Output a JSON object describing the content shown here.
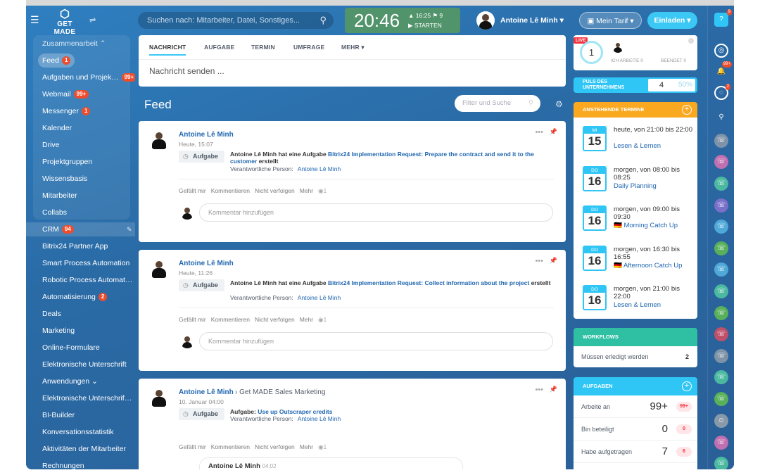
{
  "header": {
    "logo_text": "GET MADE",
    "search_placeholder": "Suchen nach: Mitarbeiter, Datei, Sonstiges...",
    "clock_time": "20:46",
    "clock_meta": "▲ 16:25  ⚑ 9",
    "clock_start": "▶ STARTEN",
    "user_name": "Antoine Lê Minh",
    "tarif_label": "Mein Tarif",
    "invite_label": "Einladen"
  },
  "sidebar": {
    "group_label": "Zusammenarbeit ⌃",
    "items": [
      {
        "label": "Feed",
        "count": "1"
      },
      {
        "label": "Aufgaben und Projek…",
        "count": "99+"
      },
      {
        "label": "Webmail",
        "count": "99+"
      },
      {
        "label": "Messenger",
        "count": "1"
      },
      {
        "label": "Kalender",
        "count": ""
      },
      {
        "label": "Drive",
        "count": ""
      },
      {
        "label": "Projektgruppen",
        "count": ""
      },
      {
        "label": "Wissensbasis",
        "count": ""
      },
      {
        "label": "Mitarbeiter",
        "count": ""
      },
      {
        "label": "Collabs",
        "count": ""
      }
    ],
    "items2": [
      {
        "label": "CRM",
        "count": "94"
      },
      {
        "label": "Bitrix24 Partner App",
        "count": ""
      },
      {
        "label": "Smart Process Automation",
        "count": ""
      },
      {
        "label": "Robotic Process Automat…",
        "count": ""
      },
      {
        "label": "Automatisierung",
        "count": "2"
      },
      {
        "label": "Deals",
        "count": ""
      },
      {
        "label": "Marketing",
        "count": ""
      },
      {
        "label": "Online-Formulare",
        "count": ""
      },
      {
        "label": "Elektronische Unterschrift",
        "count": ""
      },
      {
        "label": "Anwendungen ⌄",
        "count": ""
      },
      {
        "label": "Elektronische Unterschrif…",
        "count": ""
      },
      {
        "label": "BI-Builder",
        "count": ""
      },
      {
        "label": "Konversationsstatistik",
        "count": ""
      },
      {
        "label": "Aktivitäten der Mitarbeiter",
        "count": ""
      },
      {
        "label": "Rechnungen",
        "count": ""
      }
    ]
  },
  "composer": {
    "tabs": [
      "NACHRICHT",
      "AUFGABE",
      "TERMIN",
      "UMFRAGE",
      "MEHR ▾"
    ],
    "placeholder": "Nachricht senden ..."
  },
  "feed": {
    "title": "Feed",
    "filter_placeholder": "Filter und Suche",
    "posts": [
      {
        "author": "Antoine Lê Minh",
        "crumb": "",
        "date": "Heute, 15:07",
        "type": "Aufgabe",
        "text_prefix": "Antoine Lê Minh hat eine Aufgabe ",
        "link": "Bitrix24 Implementation Request: Prepare the contract and send it to the customer",
        "text_suffix": " erstellt",
        "resp_label": "Verantwortliche Person:",
        "resp_name": "Antoine Lê Minh",
        "actions": [
          "Gefällt mir",
          "Kommentieren",
          "Nicht verfolgen",
          "Mehr",
          "◉1"
        ],
        "comment_placeholder": "Kommentar hinzufügen"
      },
      {
        "author": "Antoine Lê Minh",
        "crumb": "",
        "date": "Heute, 11:26",
        "type": "Aufgabe",
        "text_prefix": "Antoine Lê Minh hat eine Aufgabe ",
        "link": "Bitrix24 Implementation Request: Collect information about the project",
        "text_suffix": " erstellt",
        "resp_label": "Verantwortliche Person:",
        "resp_name": "Antoine Lê Minh",
        "actions": [
          "Gefällt mir",
          "Kommentieren",
          "Nicht verfolgen",
          "Mehr",
          "◉1"
        ],
        "comment_placeholder": "Kommentar hinzufügen"
      },
      {
        "author": "Antoine Lê Minh",
        "crumb": "›  Get MADE Sales Marketing",
        "date": "10. Januar 04:00",
        "type": "Aufgabe",
        "text_prefix": "Aufgabe: ",
        "link": "Use up Outscraper credits",
        "text_suffix": "",
        "resp_label": "Verantwortliche Person:",
        "resp_name": "Antoine Lê Minh",
        "actions": [
          "Gefällt mir",
          "Kommentieren",
          "Nicht verfolgen",
          "Mehr",
          "◉1"
        ],
        "comment_author": "Antoine Lê Minh",
        "comment_time": "04:02"
      }
    ]
  },
  "right": {
    "live_tag": "LIVE",
    "live_count": "1",
    "ich_arbeite": "ICH ARBEITE 0",
    "beendet": "BEENDET 0",
    "puls_label": "PULS DES UNTERNEHMENS",
    "puls_value": "4",
    "puls_percent": "50%",
    "termine_title": "ANSTEHENDE TERMINE",
    "events": [
      {
        "dow": "MI",
        "day": "15",
        "when": "heute, von 21:00 bis 22:00",
        "what": "Lesen & Lernen"
      },
      {
        "dow": "DO",
        "day": "16",
        "when": "morgen, von 08:00 bis 08:25",
        "what": "Daily Planning"
      },
      {
        "dow": "DO",
        "day": "16",
        "when": "morgen, von 09:00 bis 09:30",
        "what": "🇩🇪 Morning Catch Up"
      },
      {
        "dow": "DO",
        "day": "16",
        "when": "morgen, von 16:30 bis 16:55",
        "what": "🇩🇪 Afternoon Catch Up"
      },
      {
        "dow": "DO",
        "day": "16",
        "when": "morgen, von 21:00 bis 22:00",
        "what": "Lesen & Lernen"
      }
    ],
    "workflows_title": "WORKFLOWS",
    "workflows_label": "Müssen erledigt werden",
    "workflows_count": "2",
    "aufgaben_title": "AUFGABEN",
    "aufgaben_rows": [
      {
        "label": "Arbeite an",
        "num": "99+",
        "badge": "99+"
      },
      {
        "label": "Bin beteiligt",
        "num": "0",
        "badge": "0"
      },
      {
        "label": "Habe aufgetragen",
        "num": "7",
        "badge": "6"
      }
    ]
  },
  "rail": {
    "help_badge": "9",
    "notif_badge": "99+",
    "chat_badge": "2"
  },
  "colors": {
    "accent": "#3bc8f5",
    "link": "#2067b0",
    "counter": "#ee4d2d",
    "termine_header": "#f9a820",
    "workflows_header": "#2fc0a4",
    "clock_bg": "#51936a"
  }
}
